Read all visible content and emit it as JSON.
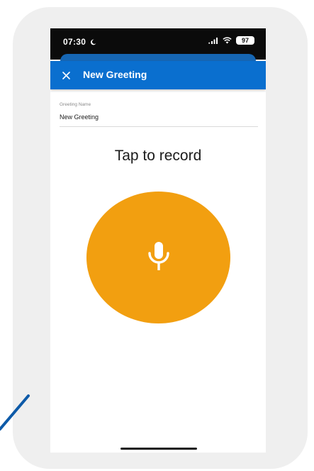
{
  "status_bar": {
    "time": "07:30",
    "moon_icon": "moon-icon",
    "signal_icon": "signal-icon",
    "wifi_icon": "wifi-icon",
    "battery_level": "97"
  },
  "app_bar": {
    "close_icon": "close-icon",
    "title": "New Greeting"
  },
  "greeting_field": {
    "label": "Greeting Name",
    "value": "New Greeting"
  },
  "record": {
    "prompt": "Tap to record",
    "icon": "microphone-icon"
  },
  "colors": {
    "app_bar": "#0a6fcf",
    "record_button": "#f29f10",
    "frame": "#efefef",
    "pointer_line": "#0d5aa8"
  }
}
